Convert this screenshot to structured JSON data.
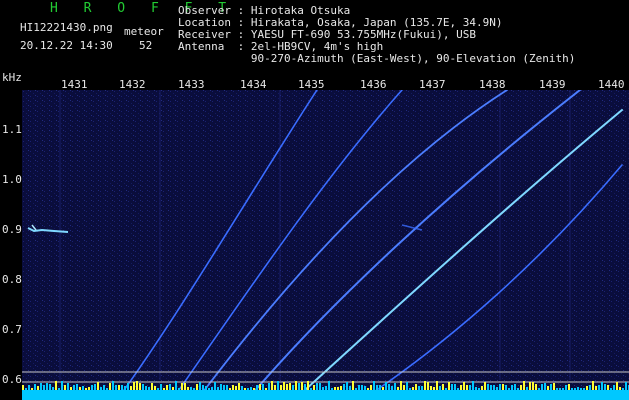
{
  "header": {
    "brand": "H R O F F T",
    "filename": "HI12221430.png",
    "datetime": "20.12.22 14:30",
    "meteor_label": "meteor",
    "meteor_count": "52",
    "info_lines": [
      "Observer : Hirotaka Otsuka",
      "Location : Hirakata, Osaka, Japan (135.7E, 34.9N)",
      "Receiver : YAESU FT-690 53.755MHz(Fukui), USB",
      "Antenna  : 2el-HB9CV, 4m's high",
      "           90-270-Azimuth (East-West), 90-Elevation (Zenith)"
    ]
  },
  "chart_data": {
    "type": "spectrogram",
    "ylabel": "kHz",
    "x_ticks": [
      "1431",
      "1432",
      "1433",
      "1434",
      "1435",
      "1436",
      "1437",
      "1438",
      "1439",
      "1440"
    ],
    "y_ticks": [
      "1.1",
      "1.0",
      "0.9",
      "0.8",
      "0.7",
      "0.6"
    ],
    "ylim": [
      0.58,
      1.17
    ],
    "colors": {
      "background": "#0a0d3c",
      "trace": "#3a6cff",
      "bright_trace": "#7fd8ff",
      "noise": "#00c8ff",
      "spikes": "#ffff33"
    }
  }
}
